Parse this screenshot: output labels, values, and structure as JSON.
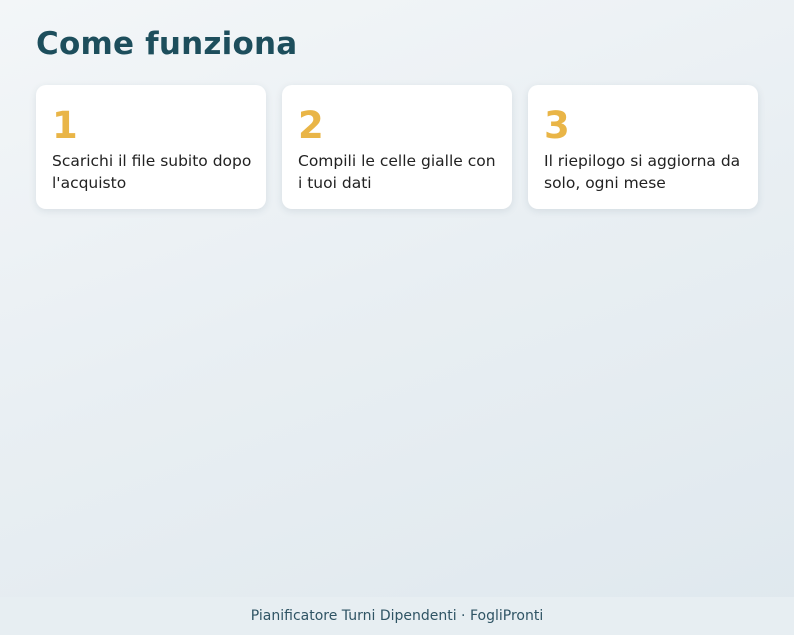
{
  "page": {
    "title": "Come funziona"
  },
  "steps": [
    {
      "number": "1",
      "text": "Scarichi il file subito dopo l'acquisto"
    },
    {
      "number": "2",
      "text": "Compili le celle gialle con i tuoi dati"
    },
    {
      "number": "3",
      "text": "Il riepilogo si aggiorna da solo, ogni mese"
    }
  ],
  "footer": {
    "text": "Pianificatore Turni Dipendenti · FogliPronti"
  },
  "colors": {
    "title": "#1d4e5c",
    "accent": "#e9b547",
    "card_background": "#ffffff",
    "footer_text": "#2f5464"
  }
}
